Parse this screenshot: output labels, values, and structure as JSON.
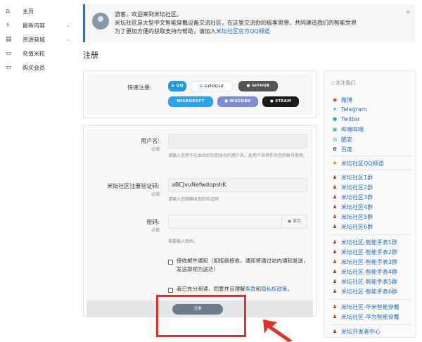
{
  "sidebar": {
    "items": [
      {
        "icon": "home-icon",
        "glyph": "⌂",
        "label": "主页",
        "chevron": ""
      },
      {
        "icon": "bolt-icon",
        "glyph": "⚡",
        "label": "最新内容",
        "chevron": "⌄"
      },
      {
        "icon": "store-icon",
        "glyph": "▤",
        "label": "资源商城",
        "chevron": "⌄"
      },
      {
        "icon": "card-icon",
        "glyph": "▭",
        "label": "充值米粒",
        "chevron": ""
      },
      {
        "icon": "monitor-icon",
        "glyph": "▭",
        "label": "购买会员",
        "chevron": ""
      }
    ]
  },
  "welcome": {
    "line1": "游客，欢迎来到米坛社区。",
    "line2": "米坛社区是大型中文智能穿戴设备交流社区，在这里交流你的极客思想，共同建造我们的智能世界",
    "line3_prefix": "为了更加方便的获取支持与帮助，请加入",
    "line3_link": "米坛社区官方QQ频道",
    "close": "×"
  },
  "page_title": "注册",
  "quick": {
    "label": "快速注册:",
    "buttons": [
      {
        "name": "qq-login-button",
        "label": "♟ QQ",
        "color": "#1e9be8"
      },
      {
        "name": "google-login-button",
        "label": "GOOGLE",
        "color": "#ffffff"
      },
      {
        "name": "github-login-button",
        "label": "● GITHUB",
        "color": "#555555"
      },
      {
        "name": "microsoft-login-button",
        "label": "MICROSOFT",
        "color": "#2aa3ef"
      },
      {
        "name": "discord-login-button",
        "label": "● DISCORD",
        "color": "#7f8bd6"
      },
      {
        "name": "steam-login-button",
        "label": "● STEAM",
        "color": "#1b1b1b"
      }
    ]
  },
  "form": {
    "username_label": "用户名:",
    "username_req": "必填",
    "username_hint": "请输入您用于在本站识别您身份的用户名。此用户名将作为您的帐号使用。",
    "captcha_label": "米坛社区注册验证码:",
    "captcha_req": "必填",
    "captcha_value": "aBCJvuNefwdopshK",
    "captcha_hint": "请输入您邮箱收到的验证码",
    "password_label": "密码:",
    "password_req": "必填",
    "password_show": "显示",
    "password_hint": "需要输入密码。",
    "email_opt": "接收邮件通知（如拒绝接收，通知将通过站内通知发送，发送即视为送达）",
    "agree_prefix": "我已充分阅读、同意并且理解",
    "agree_link1": "条款",
    "agree_mid": "和",
    "agree_link2": "隐私权政策",
    "agree_suffix": "。",
    "submit": "注册"
  },
  "right_panel": {
    "title": "关注我们",
    "social": [
      {
        "icon": "weibo-icon",
        "glyph": "◉",
        "label": "微博",
        "color": "#e6162d"
      },
      {
        "icon": "telegram-icon",
        "glyph": "➤",
        "label": "Telegram",
        "color": "#2aa3ef"
      },
      {
        "icon": "twitter-icon",
        "glyph": "●",
        "label": "Twitter",
        "color": "#1da1f2"
      },
      {
        "icon": "bilibili-icon",
        "glyph": "▣",
        "label": "哔哩哔哩",
        "color": "#23ade5"
      },
      {
        "icon": "coolapk-icon",
        "glyph": "◎",
        "label": "酷安",
        "color": "#11a05a"
      },
      {
        "icon": "baidu-icon",
        "glyph": "✿",
        "label": "百度",
        "color": "#2932e1"
      }
    ],
    "channel": "米坛社区QQ频道",
    "groups1": [
      "米坛社区1群",
      "米坛社区2群",
      "米坛社区3群",
      "米坛社区4群",
      "米坛社区5群",
      "米坛社区6群"
    ],
    "groups2": [
      "米坛社区-智能手表1群",
      "米坛社区-智能手表2群",
      "米坛社区-智能手表3群",
      "米坛社区-智能手表4群",
      "米坛社区-智能手表5群",
      "米坛社区-智能手表6群"
    ],
    "groups3": [
      "米坛社区-华米智能穿戴",
      "米坛社区-华为智能穿戴"
    ],
    "dev": "米坛开发者中心"
  }
}
